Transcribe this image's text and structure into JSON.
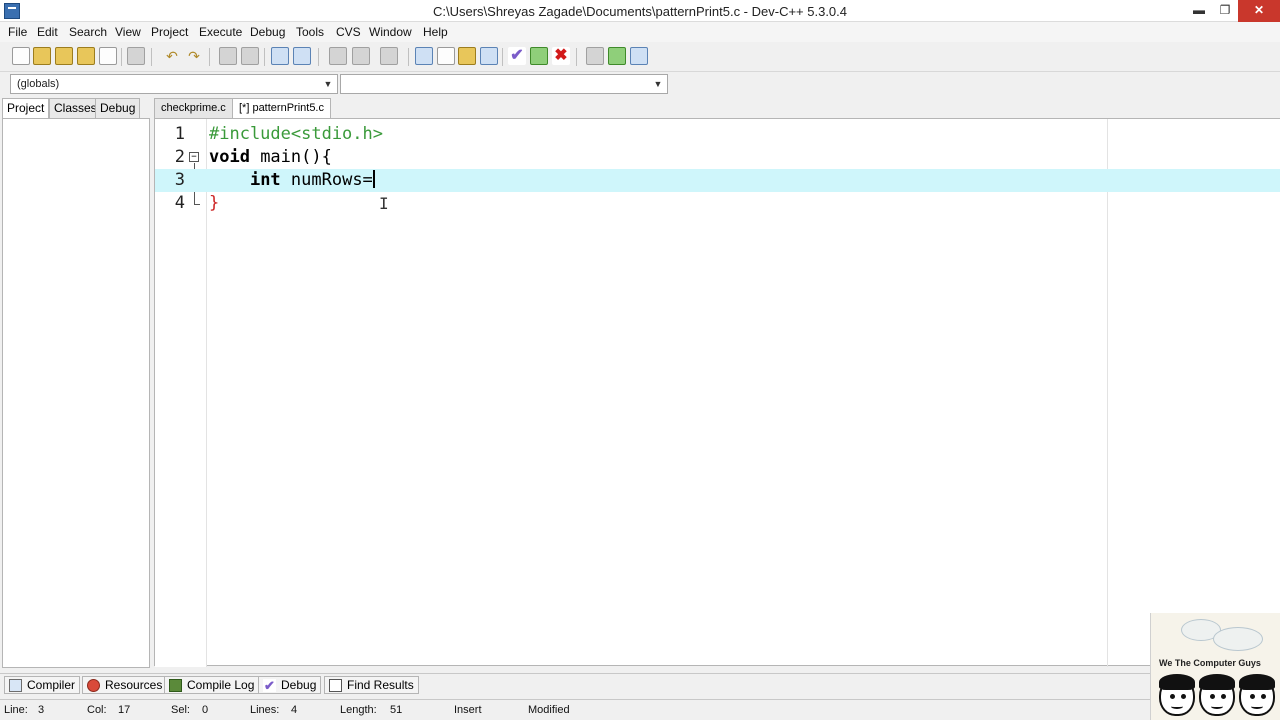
{
  "window": {
    "title": "C:\\Users\\Shreyas Zagade\\Documents\\patternPrint5.c - Dev-C++ 5.3.0.4",
    "min_glyph": "▬",
    "max_glyph": "❐",
    "close_glyph": "✕"
  },
  "menu": [
    "File",
    "Edit",
    "Search",
    "View",
    "Project",
    "Execute",
    "Debug",
    "Tools",
    "CVS",
    "Window",
    "Help"
  ],
  "combos": {
    "scope": "(globals)",
    "function": ""
  },
  "left_tabs": [
    "Project",
    "Classes",
    "Debug"
  ],
  "editor_tabs": [
    "checkprime.c",
    "[*] patternPrint5.c"
  ],
  "code": {
    "line_numbers": [
      "1",
      "2",
      "3",
      "4"
    ],
    "line1": "#include<stdio.h>",
    "line2_kw": "void",
    "line2_rest": " main(){",
    "line3_indent": "    ",
    "line3_kw": "int",
    "line3_rest": " numRows=",
    "line4": "}",
    "current_line": 3
  },
  "bottom_tabs": [
    "Compiler",
    "Resources",
    "Compile Log",
    "Debug",
    "Find Results"
  ],
  "status": {
    "line_label": "Line:",
    "line_value": "3",
    "col_label": "Col:",
    "col_value": "17",
    "sel_label": "Sel:",
    "sel_value": "0",
    "lines_label": "Lines:",
    "lines_value": "4",
    "length_label": "Length:",
    "length_value": "51",
    "mode": "Insert",
    "state": "Modified"
  },
  "watermark": {
    "text": "We The Computer Guys"
  }
}
